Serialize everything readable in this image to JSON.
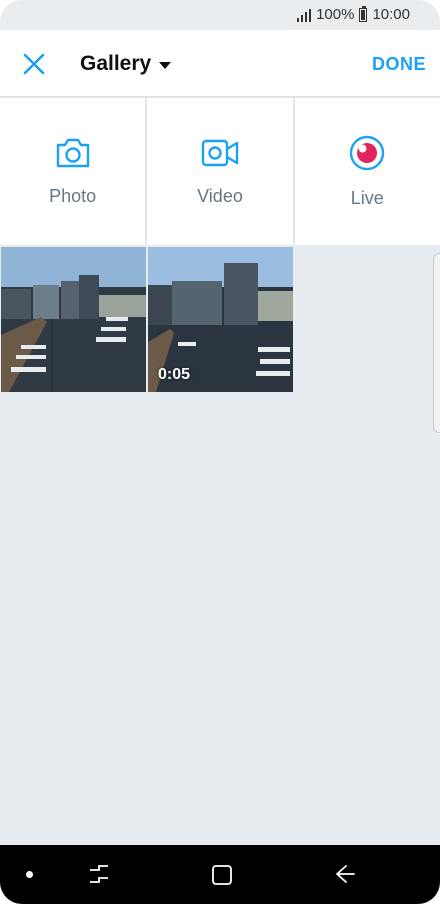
{
  "status_bar": {
    "battery": "100%",
    "time": "10:00"
  },
  "header": {
    "title": "Gallery",
    "done_label": "DONE"
  },
  "options": [
    {
      "label": "Photo",
      "icon": "camera-icon"
    },
    {
      "label": "Video",
      "icon": "video-camera-icon"
    },
    {
      "label": "Live",
      "icon": "live-broadcast-icon"
    }
  ],
  "gallery": {
    "items": [
      {
        "type": "photo"
      },
      {
        "type": "video",
        "duration": "0:05"
      }
    ]
  },
  "colors": {
    "accent": "#1da1f2",
    "live": "#e0245e",
    "label": "#657786"
  }
}
